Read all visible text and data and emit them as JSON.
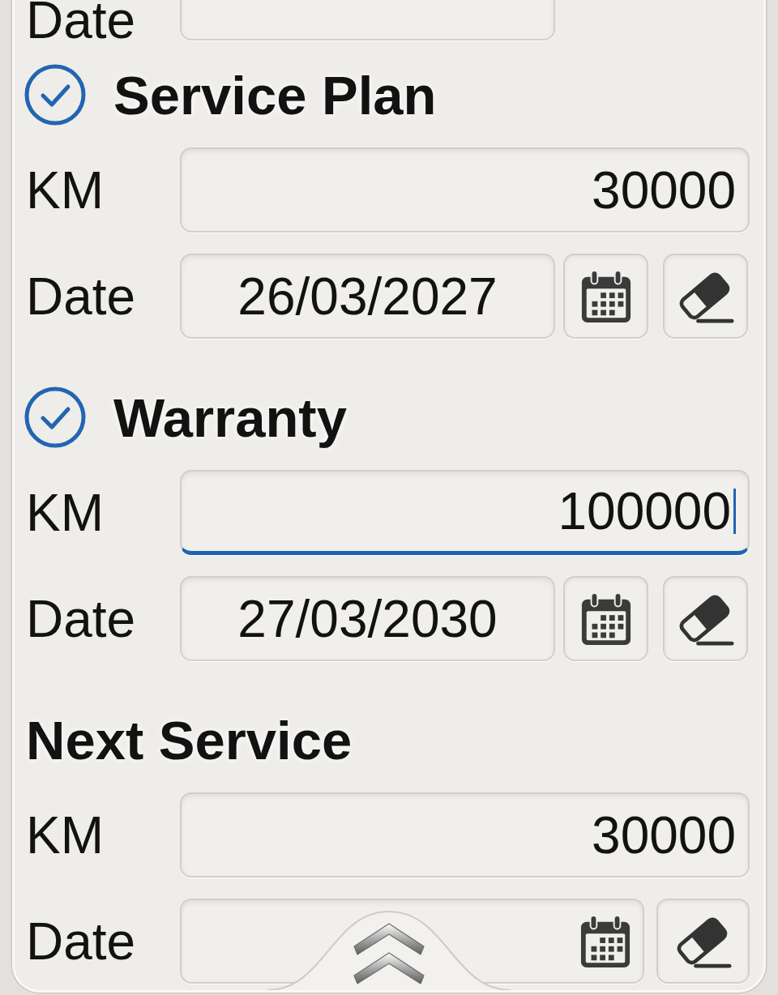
{
  "partial_row": {
    "label": "Date"
  },
  "sections": [
    {
      "title": "Service Plan",
      "kind": "checkable",
      "checked": true,
      "rows": [
        {
          "kind": "number",
          "label": "KM",
          "value": "30000",
          "focused": false
        },
        {
          "kind": "date",
          "label": "Date",
          "value": "26/03/2027"
        }
      ]
    },
    {
      "title": "Warranty",
      "kind": "checkable",
      "checked": true,
      "rows": [
        {
          "kind": "number",
          "label": "KM",
          "value": "100000",
          "focused": true
        },
        {
          "kind": "date",
          "label": "Date",
          "value": "27/03/2030"
        }
      ]
    },
    {
      "title": "Next Service",
      "kind": "plain",
      "rows": [
        {
          "kind": "number",
          "label": "KM",
          "value": "30000",
          "focused": false
        },
        {
          "kind": "date_inline",
          "label": "Date"
        }
      ]
    }
  ]
}
